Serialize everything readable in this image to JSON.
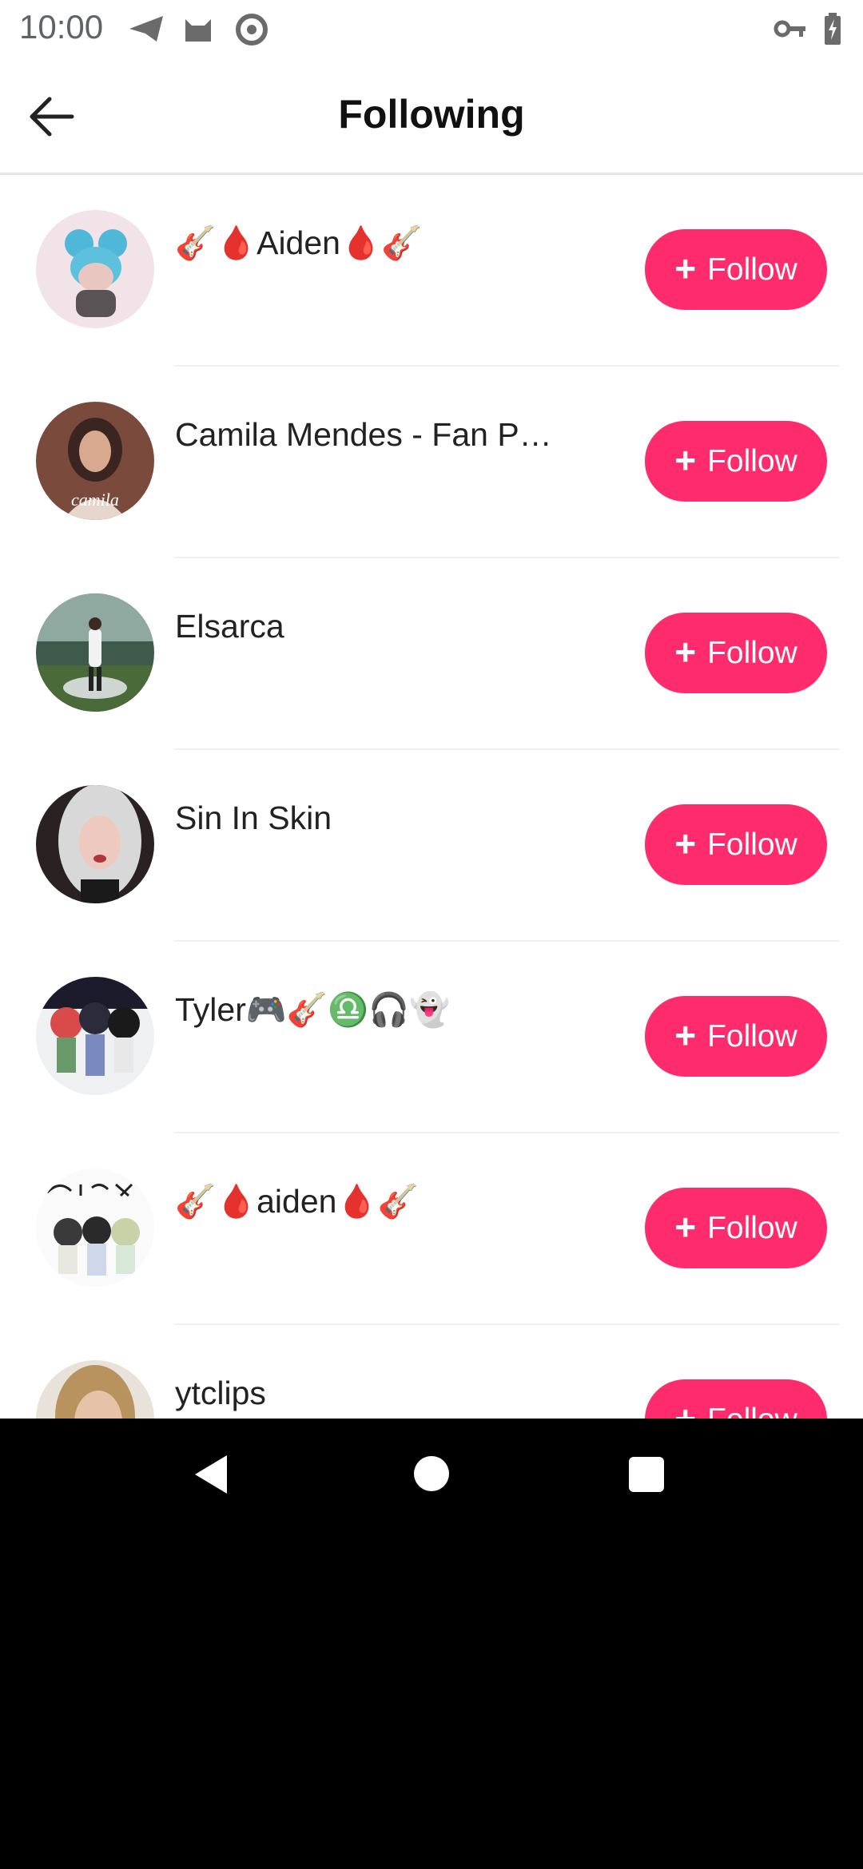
{
  "status": {
    "time": "10:00",
    "icons": [
      "send-icon",
      "cat-icon",
      "at-sign-icon",
      "vpn-key-icon",
      "battery-charging-icon"
    ]
  },
  "appbar": {
    "title": "Following",
    "back_icon": "arrow-left-icon"
  },
  "users": [
    {
      "name": "🎸🩸Aiden🩸🎸",
      "button": "Follow",
      "avatar": "blue-hair-doll"
    },
    {
      "name": "Camila Mendes - Fan Pa…",
      "button": "Follow",
      "avatar": "woman-portrait"
    },
    {
      "name": "Elsarca",
      "button": "Follow",
      "avatar": "stadium-performer"
    },
    {
      "name": "Sin In Skin",
      "button": "Follow",
      "avatar": "white-hair-portrait"
    },
    {
      "name": "Tyler🎮🎸♎🎧👻",
      "button": "Follow",
      "avatar": "cartoon-group"
    },
    {
      "name": "🎸🩸aiden🩸🎸",
      "button": "Follow",
      "avatar": "sketch-group"
    },
    {
      "name": "ytclips",
      "button": "Follow",
      "avatar": "blonde-portrait"
    }
  ],
  "colors": {
    "accent": "#fe2c6d",
    "background": "#ffffff"
  }
}
